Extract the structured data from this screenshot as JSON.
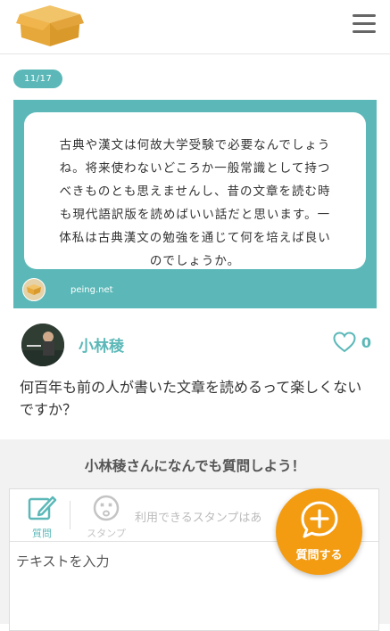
{
  "header": {
    "logo_icon": "cardboard-box-icon",
    "menu_icon": "hamburger-menu-icon"
  },
  "question": {
    "date": "11/17",
    "lines": [
      "古典や漢文は何故大学受験で必要なんでしょう",
      "ね。将来使わないどころか一般常識として持つ",
      "べきものとも思えませんし、昔の文章を読む時",
      "も現代語訳版を読めばいい話だと思います。一",
      "体私は古典漢文の勉強を通じて何を培えば良い",
      "のでしょうか。"
    ],
    "site": "peing.net"
  },
  "answer": {
    "author": "小林稜",
    "likes": "0",
    "text": "何百年も前の人が書いた文章を読めるって楽しくないですか？"
  },
  "ask": {
    "title": "小林稜さんになんでも質問しよう！",
    "tool_question": "質問",
    "tool_stamp": "スタンプ",
    "stamp_hint": "利用できるスタンプはあ",
    "placeholder": "テキストを入力",
    "fab_label": "質問する"
  },
  "colors": {
    "accent": "#5cb8b8",
    "fab": "#f39c12"
  }
}
